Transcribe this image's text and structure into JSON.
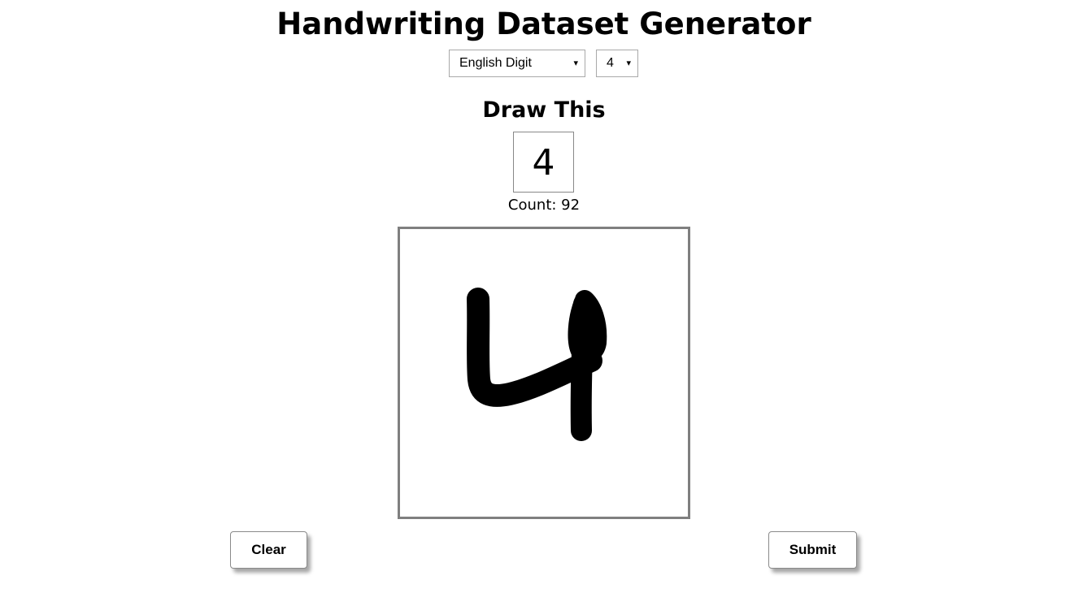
{
  "app": {
    "title": "Handwriting Dataset Generator"
  },
  "controls": {
    "script_select": {
      "selected": "English Digit",
      "caret": "▾"
    },
    "digit_select": {
      "selected": "4",
      "caret": "▾"
    }
  },
  "prompt": {
    "heading": "Draw This",
    "target_character": "4",
    "count_text": "Count: 92"
  },
  "canvas": {
    "stroke_color": "#000000",
    "border_color": "#7f7f7f"
  },
  "actions": {
    "clear_label": "Clear",
    "submit_label": "Submit"
  }
}
